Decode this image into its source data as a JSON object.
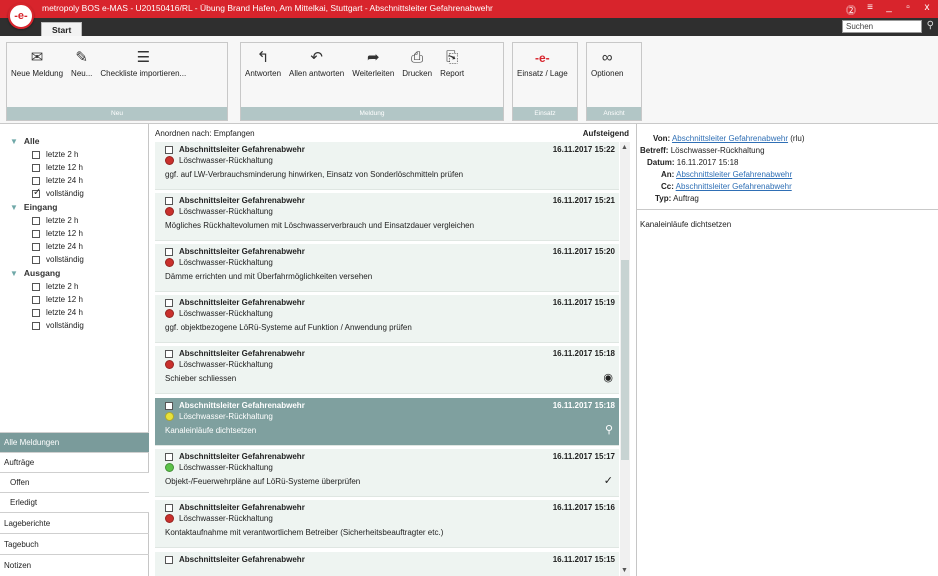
{
  "window": {
    "title": "metropoly BOS e-MAS - U20150416/RL - Übung Brand Hafen, Am Mittelkai, Stuttgart - Abschnittsleiter Gefahrenabwehr",
    "logo_text": "-e-",
    "controls": [
      "⓶",
      "≡",
      "_",
      "▫",
      "x"
    ]
  },
  "tabs": {
    "start": "Start"
  },
  "search": {
    "placeholder": "Suchen"
  },
  "ribbon": {
    "neu": {
      "label": "Neu",
      "buttons": [
        "Neue Meldung",
        "Neu...",
        "Checkliste importieren..."
      ]
    },
    "meldung": {
      "label": "Meldung",
      "buttons": [
        "Antworten",
        "Allen antworten",
        "Weiterleiten",
        "Drucken",
        "Report"
      ]
    },
    "einsatz": {
      "label": "Einsatz",
      "buttons": [
        "Einsatz / Lage"
      ]
    },
    "ansicht": {
      "label": "Ansicht",
      "buttons": [
        "Optionen"
      ]
    }
  },
  "tree": {
    "alle": {
      "label": "Alle",
      "items": [
        "letzte 2 h",
        "letzte 12 h",
        "letzte 24 h",
        "vollständig"
      ]
    },
    "eingang": {
      "label": "Eingang",
      "items": [
        "letzte 2 h",
        "letzte 12 h",
        "letzte 24 h",
        "vollständig"
      ]
    },
    "ausgang": {
      "label": "Ausgang",
      "items": [
        "letzte 2 h",
        "letzte 12 h",
        "letzte 24 h",
        "vollständig"
      ]
    }
  },
  "nav": [
    "Alle Meldungen",
    "Aufträge",
    "Offen",
    "Erledigt",
    "Lageberichte",
    "Tagebuch",
    "Notizen"
  ],
  "list": {
    "sort_label": "Anordnen nach: Empfangen",
    "sort_order": "Aufsteigend",
    "messages": [
      {
        "from": "Abschnittsleiter Gefahrenabwehr",
        "date": "16.11.2017 15:22",
        "subject": "Löschwasser-Rückhaltung",
        "text": "ggf. auf LW-Verbrauchsminderung hinwirken, Einsatz von Sonderlöschmitteln prüfen",
        "status_color": "#c9302c",
        "marker": ""
      },
      {
        "from": "Abschnittsleiter Gefahrenabwehr",
        "date": "16.11.2017 15:21",
        "subject": "Löschwasser-Rückhaltung",
        "text": "Mögliches Rückhaltevolumen mit Löschwasserverbrauch und Einsatzdauer vergleichen",
        "status_color": "#c9302c",
        "marker": ""
      },
      {
        "from": "Abschnittsleiter Gefahrenabwehr",
        "date": "16.11.2017 15:20",
        "subject": "Löschwasser-Rückhaltung",
        "text": "Dämme errichten und mit Überfahrmöglichkeiten versehen",
        "status_color": "#c9302c",
        "marker": ""
      },
      {
        "from": "Abschnittsleiter Gefahrenabwehr",
        "date": "16.11.2017 15:19",
        "subject": "Löschwasser-Rückhaltung",
        "text": "ggf. objektbezogene LöRü-Systeme auf Funktion / Anwendung prüfen",
        "status_color": "#c9302c",
        "marker": ""
      },
      {
        "from": "Abschnittsleiter Gefahrenabwehr",
        "date": "16.11.2017 15:18",
        "subject": "Löschwasser-Rückhaltung",
        "text": "Schieber schliessen",
        "status_color": "#c9302c",
        "marker": "◉"
      },
      {
        "from": "Abschnittsleiter Gefahrenabwehr",
        "date": "16.11.2017 15:18",
        "subject": "Löschwasser-Rückhaltung",
        "text": "Kanaleinläufe dichtsetzen",
        "status_color": "#e8e23a",
        "marker": "⚲"
      },
      {
        "from": "Abschnittsleiter Gefahrenabwehr",
        "date": "16.11.2017 15:17",
        "subject": "Löschwasser-Rückhaltung",
        "text": "Objekt-/Feuerwehrpläne auf LöRü-Systeme überprüfen",
        "status_color": "#5cc24a",
        "marker": "✓"
      },
      {
        "from": "Abschnittsleiter Gefahrenabwehr",
        "date": "16.11.2017 15:16",
        "subject": "Löschwasser-Rückhaltung",
        "text": "Kontaktaufnahme mit verantwortlichem Betreiber (Sicherheitsbeauftragter etc.)",
        "status_color": "#c9302c",
        "marker": ""
      },
      {
        "from": "Abschnittsleiter Gefahrenabwehr",
        "date": "16.11.2017 15:15",
        "subject": "",
        "text": "",
        "status_color": "#c9302c",
        "marker": ""
      }
    ]
  },
  "detail": {
    "von_label": "Von:",
    "von_value": "Abschnittsleiter Gefahrenabwehr",
    "von_suffix": "(rlu)",
    "betreff_label": "Betreff:",
    "betreff_value": "Löschwasser-Rückhaltung",
    "datum_label": "Datum:",
    "datum_value": "16.11.2017 15:18",
    "an_label": "An:",
    "an_value": "Abschnittsleiter Gefahrenabwehr",
    "cc_label": "Cc:",
    "cc_value": "Abschnittsleiter Gefahrenabwehr",
    "typ_label": "Typ:",
    "typ_value": "Auftrag",
    "body": "Kanaleinläufe dichtsetzen"
  }
}
